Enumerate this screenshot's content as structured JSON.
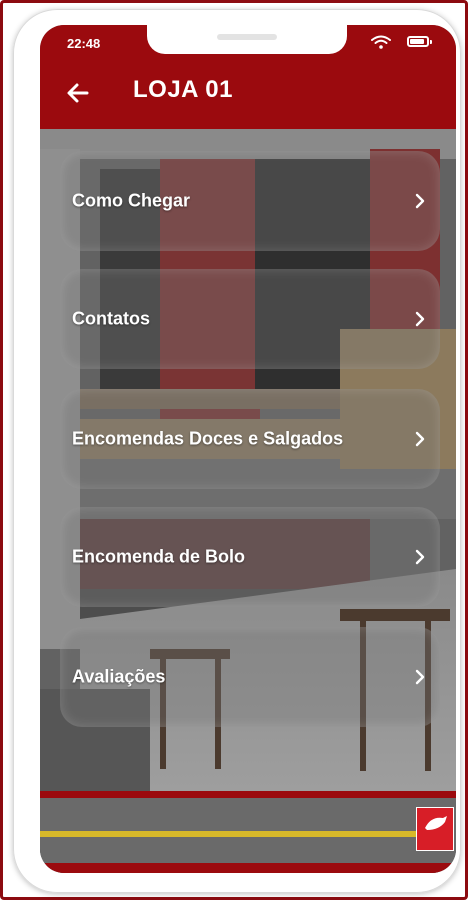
{
  "status_bar": {
    "time": "22:48",
    "wifi_icon": "wifi-icon",
    "battery_icon": "battery-icon"
  },
  "header": {
    "title": "LOJA 01",
    "back_icon": "arrow-left-icon",
    "background_color": "#9b0a0e"
  },
  "menu": {
    "items": [
      {
        "label": "Como Chegar",
        "icon": "chevron-right-icon"
      },
      {
        "label": "Contatos",
        "icon": "chevron-right-icon"
      },
      {
        "label": "Encomendas Doces e Salgados",
        "icon": "chevron-right-icon"
      },
      {
        "label": "Encomenda de Bolo",
        "icon": "chevron-right-icon"
      },
      {
        "label": "Avaliações",
        "icon": "chevron-right-icon"
      }
    ]
  },
  "colors": {
    "brand_red": "#9b0a0e",
    "banner_logo_red": "#d71e27",
    "road_stripe_yellow": "#d8b92a"
  }
}
